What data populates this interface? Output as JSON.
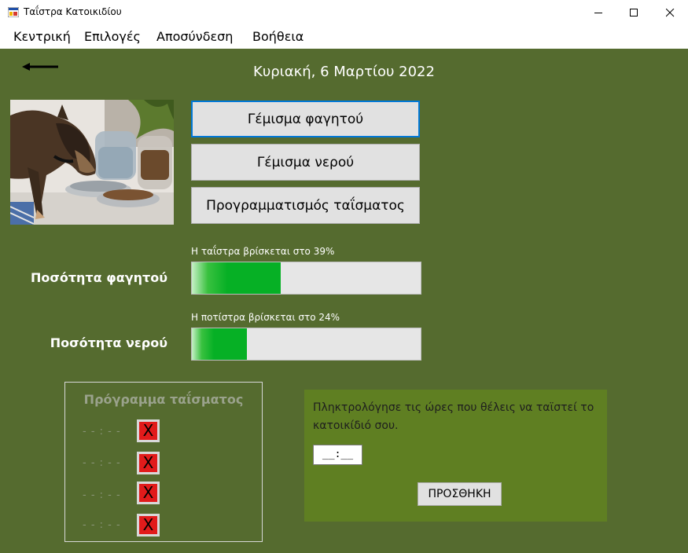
{
  "window": {
    "title": "Ταΐστρα Κατοικιδίου",
    "minimize_glyph": "—",
    "maximize_glyph": "☐",
    "close_glyph": "✕"
  },
  "menu": {
    "items": [
      "Κεντρική",
      "Επιλογές",
      "Αποσύνδεση",
      "Βοήθεια"
    ]
  },
  "header": {
    "date": "Κυριακή, 6 Μαρτίου 2022"
  },
  "actions": {
    "fill_food": "Γέμισμα φαγητού",
    "fill_water": "Γέμισμα νερού",
    "schedule_feeding": "Προγραμματισμός ταΐσματος"
  },
  "food": {
    "label": "Ποσότητα φαγητού",
    "caption": "Η ταΐστρα βρίσκεται στο 39%",
    "percent": 39
  },
  "water": {
    "label": "Ποσότητα νερού",
    "caption": "Η ποτίστρα βρίσκεται στο 24%",
    "percent": 24
  },
  "schedule": {
    "title": "Πρόγραμμα ταΐσματος",
    "slots": [
      {
        "time": "- - : - -",
        "remove": "X"
      },
      {
        "time": "- - : - -",
        "remove": "X"
      },
      {
        "time": "- - : - -",
        "remove": "X"
      },
      {
        "time": "- - : - -",
        "remove": "X"
      }
    ]
  },
  "entry": {
    "instruction": "Πληκτρολόγησε τις ώρες που θέλεις να ταϊστεί το κατοικίδιό σου.",
    "time_value": "__:__",
    "add_label": "ΠΡΟΣΘΗΚΗ"
  },
  "colors": {
    "background": "#556b2f",
    "entry_panel": "#5f7f22",
    "progress_green": "#06b025",
    "remove_red": "#e11b1b",
    "focus_blue": "#0078d7"
  },
  "icons": {
    "app": "app-icon",
    "back": "back-arrow-icon",
    "photo": "dog-eating-photo"
  }
}
